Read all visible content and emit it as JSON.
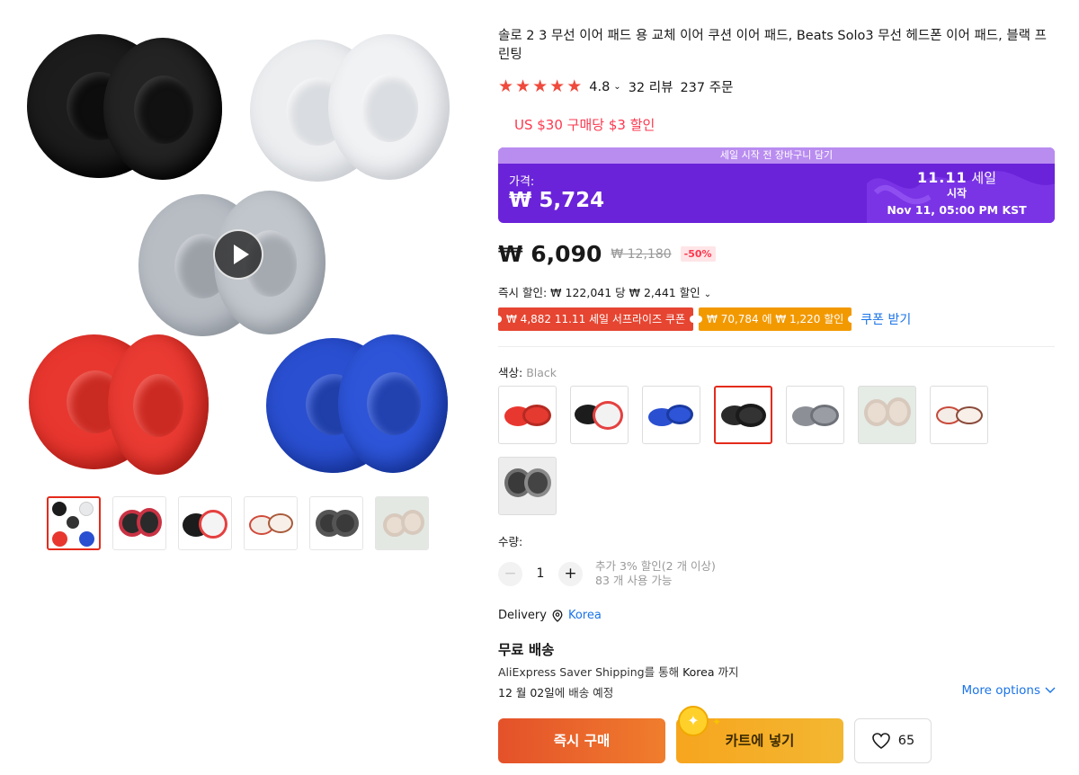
{
  "colors": {
    "accent_red": "#ef4a3c",
    "sale_purple": "#6a23d9",
    "link_blue": "#1a73e8",
    "buy_orange": "#e4512a",
    "cart_yellow": "#f7a51f"
  },
  "gallery": {
    "thumbnails": [
      "black-white-grey-red-blue set",
      "black-red pads",
      "white-red pads",
      "printed pads",
      "dark grey pads",
      "beige pads"
    ],
    "active_thumbnail": 0
  },
  "product": {
    "title": "솔로 2 3 무선 이어 패드 용 교체 이어 쿠션 이어 패드, Beats Solo3 무선 헤드폰 이어 패드, 블랙 프린팅",
    "rating": "4.8",
    "rating_chevron": "⌄",
    "reviews": "32 리뷰",
    "orders": "237 주문",
    "promo": "US $30 구매당 $3 할인"
  },
  "sale": {
    "strip": "세일 시작 전 장바구니 담기",
    "price_label": "가격:",
    "price": "₩ 5,724",
    "event_name": "11.11",
    "event_suffix": "세일",
    "event_start": "시작",
    "event_time": "Nov 11, 05:00 PM KST"
  },
  "pricing": {
    "price": "₩ 6,090",
    "original": "₩ 12,180",
    "discount": "-50%",
    "instant": "즉시 할인: ₩ 122,041 당 ₩ 2,441 할인",
    "instant_chevron": "⌄"
  },
  "coupons": {
    "coupon1": "₩ 4,882 11.11 세일 서프라이즈 쿠폰",
    "coupon2": "₩ 70,784 에 ₩ 1,220 할인",
    "link": "쿠폰 받기"
  },
  "color": {
    "label": "색상:",
    "selected": "Black",
    "options": [
      "red",
      "white-black",
      "blue",
      "black",
      "grey",
      "beige",
      "printed",
      "camo"
    ],
    "selected_index": 3
  },
  "quantity": {
    "label": "수량:",
    "minus": "−",
    "value": "1",
    "plus": "+",
    "note1": "추가 3% 할인(2 개 이상)",
    "note2": "83 개 사용 가능"
  },
  "delivery": {
    "label": "Delivery",
    "location": "Korea",
    "title": "무료 배송",
    "method": "AliExpress Saver Shipping",
    "method_suffix": "를 통해",
    "dest": "Korea",
    "dest_suffix": "까지",
    "date": "12 월 02일",
    "date_suffix": "에 배송 예정",
    "more_options": "More options"
  },
  "actions": {
    "buy": "즉시 구매",
    "cart": "카트에 넣기",
    "wish_count": "65"
  }
}
